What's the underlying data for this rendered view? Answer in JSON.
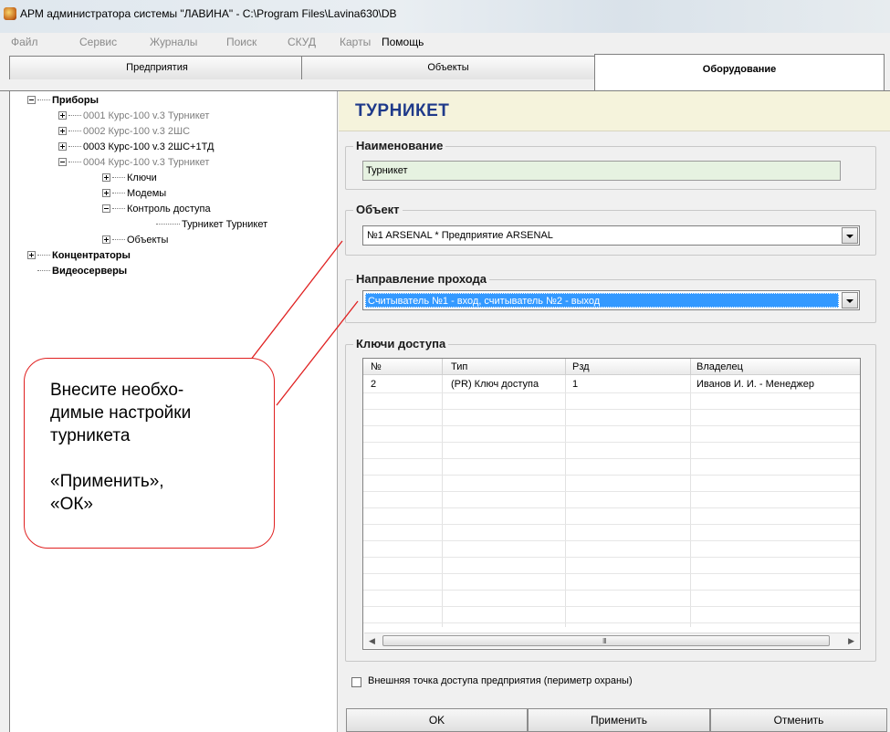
{
  "window": {
    "title": "АРМ администратора системы \"ЛАВИНА\" - C:\\Program Files\\Lavina630\\DB"
  },
  "menu": [
    {
      "label": "Файл",
      "enabled": false
    },
    {
      "label": "Сервис",
      "enabled": false
    },
    {
      "label": "Журналы",
      "enabled": false
    },
    {
      "label": "Поиск",
      "enabled": false
    },
    {
      "label": "СКУД",
      "enabled": false
    },
    {
      "label": "Карты",
      "enabled": false
    },
    {
      "label": "Помощь",
      "enabled": true
    }
  ],
  "tabs": [
    {
      "label": "Предприятия",
      "selected": false
    },
    {
      "label": "Объекты",
      "selected": false
    },
    {
      "label": "Оборудование",
      "selected": true
    }
  ],
  "tree": [
    {
      "label": "Приборы",
      "level": 0,
      "expander": "minus",
      "style": "bold"
    },
    {
      "label": "0001  Курс-100 v.3 Турникет",
      "level": 1,
      "expander": "plus",
      "style": "gray"
    },
    {
      "label": "0002  Курс-100 v.3 2ШС",
      "level": 1,
      "expander": "plus",
      "style": "gray"
    },
    {
      "label": "0003  Курс-100 v.3 2ШС+1ТД",
      "level": 1,
      "expander": "plus",
      "style": "black"
    },
    {
      "label": "0004  Курс-100 v.3 Турникет",
      "level": 1,
      "expander": "minus",
      "style": "gray"
    },
    {
      "label": "Ключи",
      "level": 2,
      "expander": "plus",
      "style": "black"
    },
    {
      "label": "Модемы",
      "level": 2,
      "expander": "plus",
      "style": "black"
    },
    {
      "label": "Контроль доступа",
      "level": 2,
      "expander": "minus",
      "style": "black"
    },
    {
      "label": "Турникет  Турникет",
      "level": 3,
      "expander": "none",
      "style": "black"
    },
    {
      "label": "Объекты",
      "level": 2,
      "expander": "plus",
      "style": "black"
    },
    {
      "label": "Концентраторы",
      "level": 0,
      "expander": "plus",
      "style": "bold"
    },
    {
      "label": "Видеосерверы",
      "level": 0,
      "expander": "none",
      "style": "bold"
    }
  ],
  "form": {
    "header": "ТУРНИКЕТ",
    "name": {
      "legend": "Наименование",
      "value": "Турникет"
    },
    "object": {
      "legend": "Объект",
      "value": "№1  ARSENAL  *  Предприятие ARSENAL"
    },
    "direction": {
      "legend": "Направление прохода",
      "value": "Считыватель №1 - вход, считыватель №2 - выход"
    },
    "keys": {
      "legend": "Ключи доступа",
      "columns": [
        "№",
        "Тип",
        "Рзд",
        "Владелец"
      ],
      "rows": [
        [
          "2",
          "(PR) Ключ доступа",
          "1",
          "Иванов И. И. - Менеджер"
        ]
      ],
      "scroll_grip": "III"
    },
    "external_point": {
      "label": "Внешняя точка доступа предприятия (периметр охраны)",
      "checked": false
    },
    "buttons": {
      "ok": "OK",
      "apply": "Применить",
      "cancel": "Отменить"
    }
  },
  "callout": {
    "lines": [
      "Внесите необхо-",
      "димые настройки",
      "турникета",
      "",
      "«Применить»,",
      "«ОК»"
    ],
    "border_color": "#e02020"
  },
  "colors": {
    "header_band": "#f5f3dc",
    "header_text": "#1f3a8a",
    "name_field_bg": "#e6f2e1",
    "selection": "#3399ff"
  }
}
